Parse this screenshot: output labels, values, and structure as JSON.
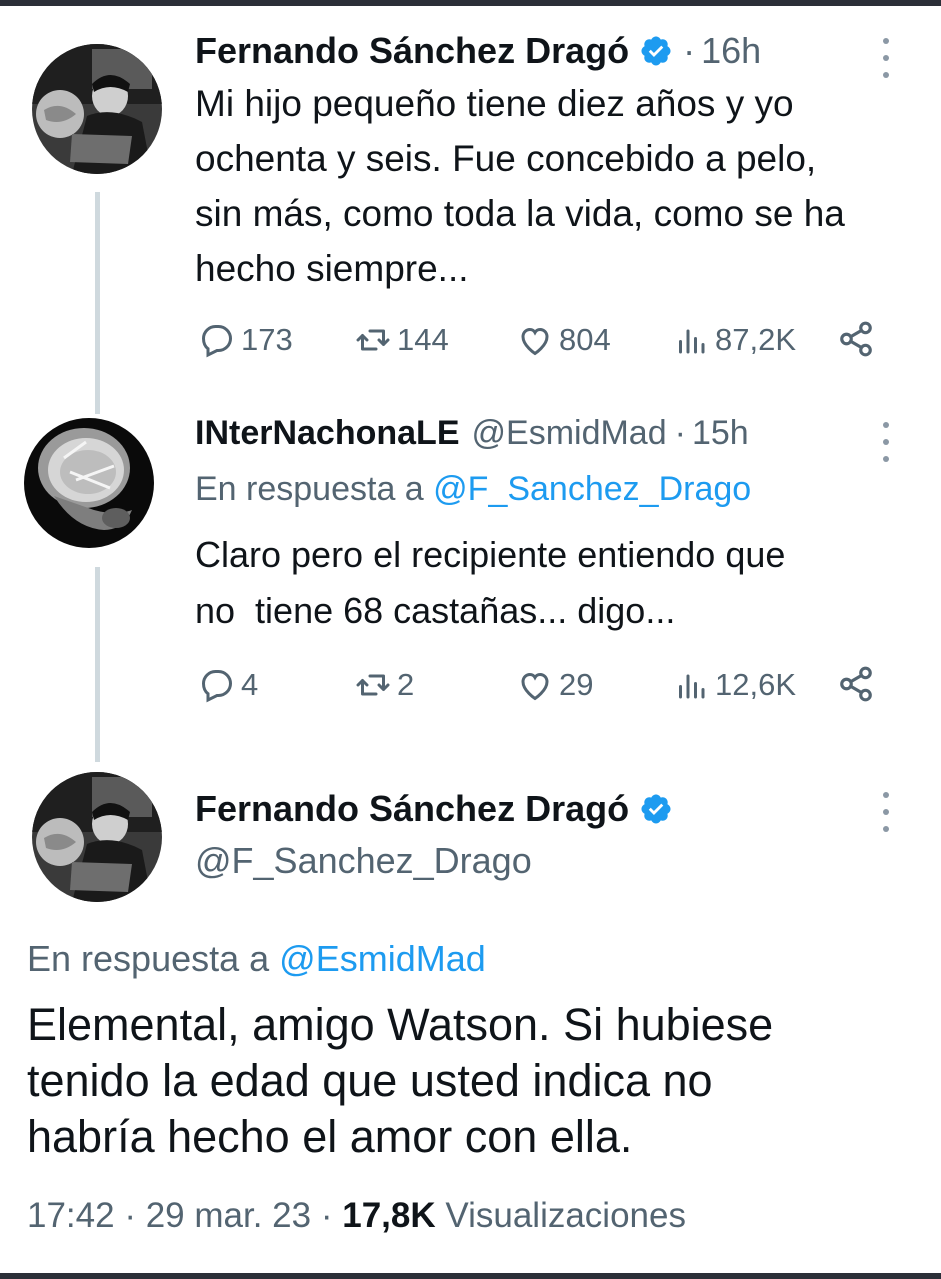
{
  "tweet1": {
    "author_name": "Fernando Sánchez Dragó",
    "time": "16h",
    "text_lines": [
      "Mi hijo pequeño tiene diez años y yo",
      "ochenta y seis. Fue concebido a pelo,",
      "sin más, como toda la vida, como se ha",
      "hecho siempre..."
    ],
    "replies": "173",
    "retweets": "144",
    "likes": "804",
    "views": "87,2K"
  },
  "tweet2": {
    "author_name": "INterNachonaLE",
    "handle": "@EsmidMad",
    "time": "15h",
    "reply_prefix": "En respuesta a",
    "reply_mention": "@F_Sanchez_Drago",
    "text_lines": [
      "Claro pero el recipiente entiendo que",
      "no  tiene 68 castañas... digo..."
    ],
    "replies": "4",
    "retweets": "2",
    "likes": "29",
    "views": "12,6K"
  },
  "main_tweet": {
    "author_name": "Fernando Sánchez Dragó",
    "handle": "@F_Sanchez_Drago",
    "reply_prefix": "En respuesta a",
    "reply_mention": "@EsmidMad",
    "text_lines": [
      "Elemental, amigo Watson. Si hubiese",
      "tenido la edad que usted indica no",
      "habría hecho el amor con ella."
    ],
    "time": "17:42",
    "date": "29 mar. 23",
    "views_count": "17,8K",
    "views_label": "Visualizaciones"
  },
  "separator": "·",
  "colors": {
    "accent": "#1d9bf0",
    "secondary_text": "#536471",
    "thread_line": "#cfd9de"
  },
  "icons": [
    "reply-icon",
    "retweet-icon",
    "like-icon",
    "views-icon",
    "share-icon",
    "verified-badge-icon",
    "more-options-icon"
  ]
}
